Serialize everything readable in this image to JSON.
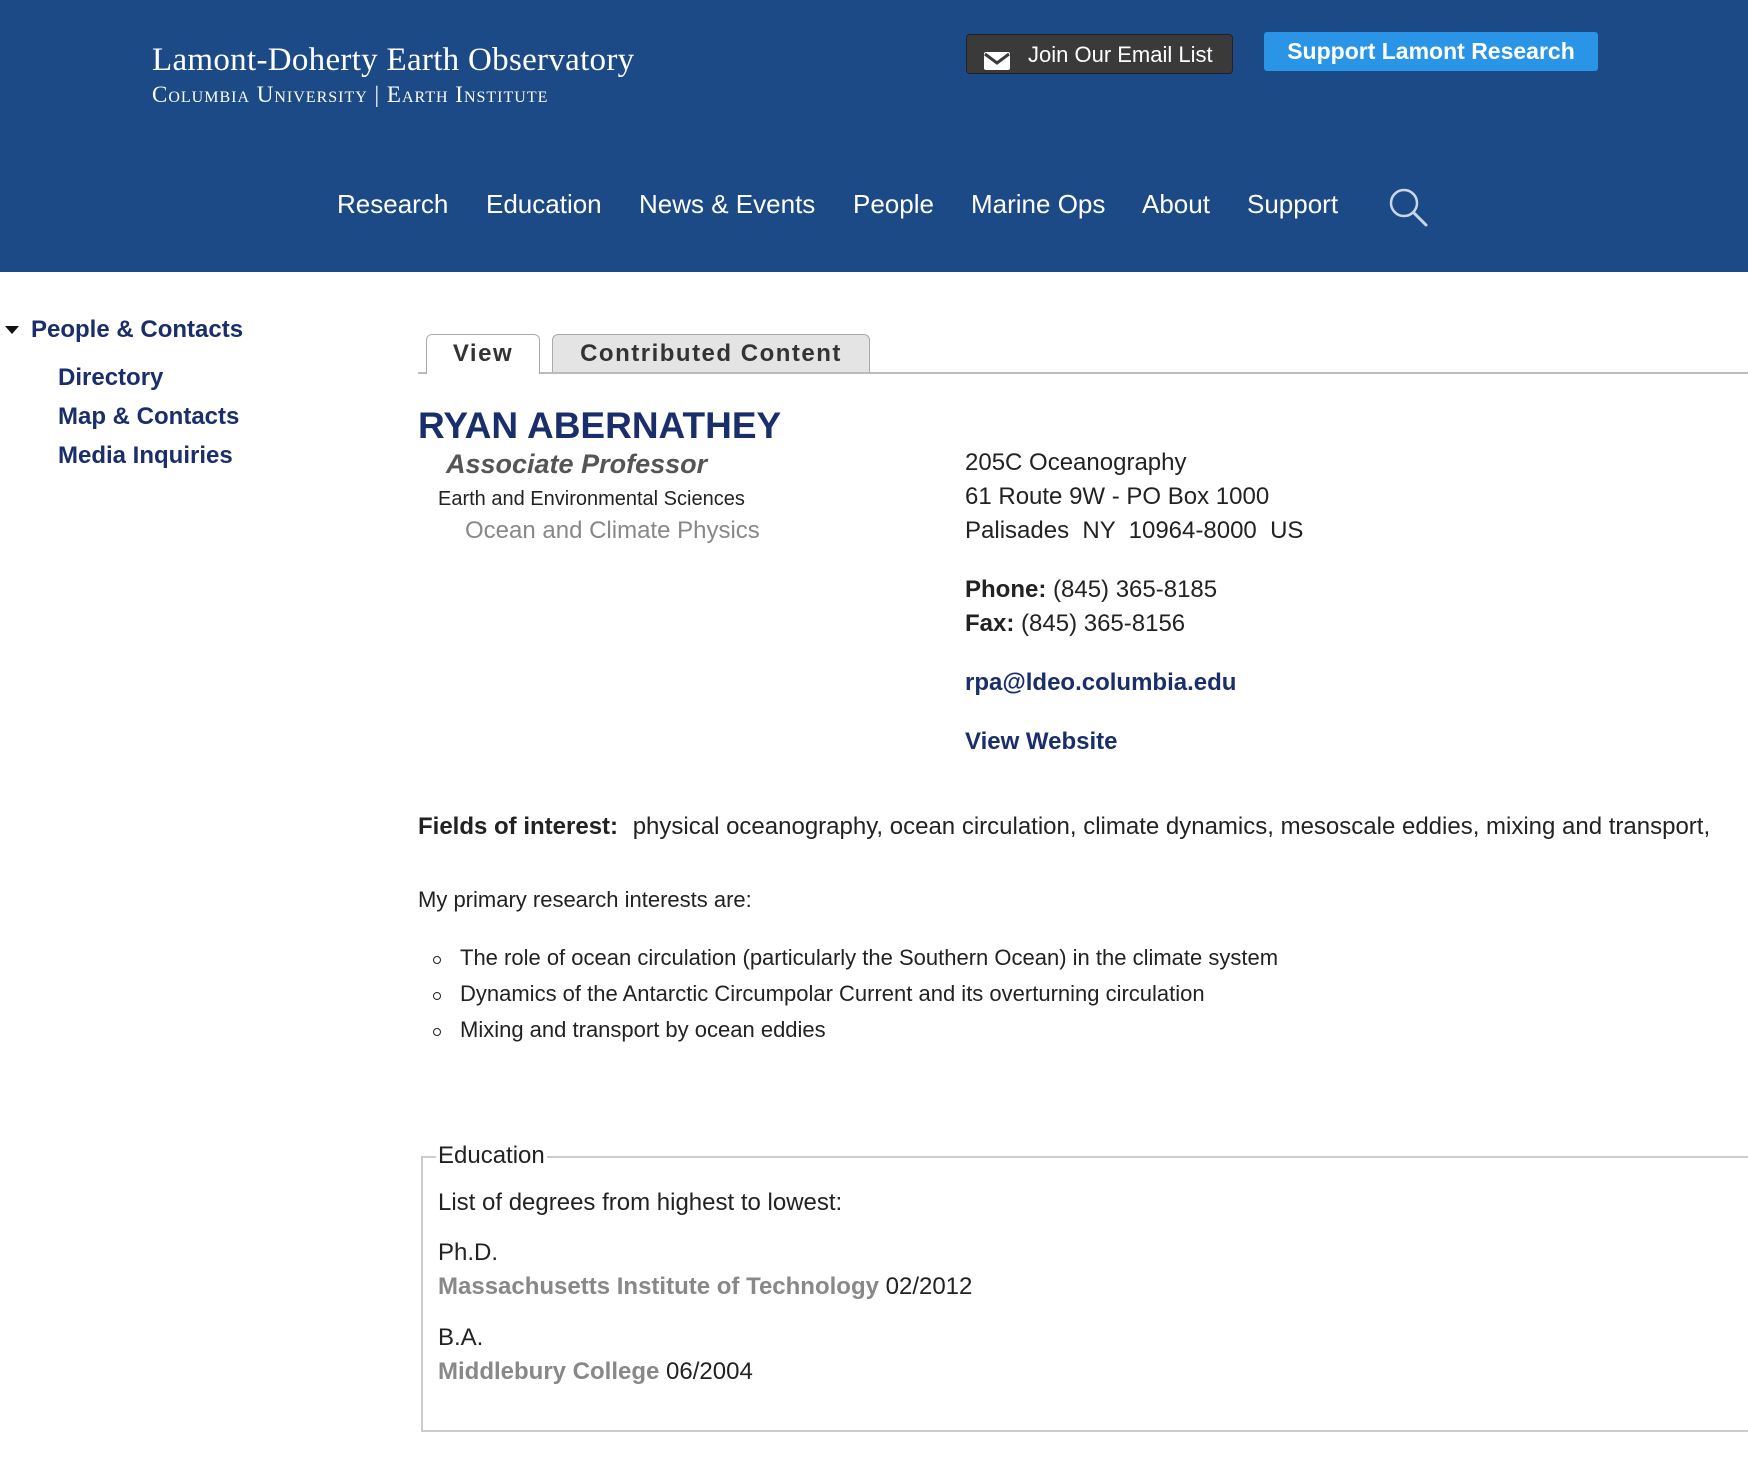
{
  "header": {
    "logo_line1": "Lamont-Doherty Earth Observatory",
    "logo_line2": "Columbia University | Earth Institute",
    "email_button": "Join Our Email List",
    "support_button": "Support Lamont Research",
    "brand_color": "#1c4a86",
    "support_color": "#2a94e6"
  },
  "nav": {
    "items": [
      "Research",
      "Education",
      "News & Events",
      "People",
      "Marine Ops",
      "About",
      "Support"
    ]
  },
  "sidebar": {
    "heading": "People & Contacts",
    "links": [
      "Directory",
      "Map & Contacts",
      "Media Inquiries"
    ]
  },
  "tabs": [
    "View",
    "Contributed Content"
  ],
  "profile": {
    "name": "RYAN ABERNATHEY",
    "title": "Associate Professor",
    "department": "Earth and Environmental Sciences",
    "division": "Ocean and Climate Physics",
    "address_lines": [
      "205C Oceanography",
      "61 Route 9W - PO Box 1000",
      "Palisades  NY  10964-8000  US"
    ],
    "phone_label": "Phone:",
    "phone": "(845) 365-8185",
    "fax_label": "Fax:",
    "fax": "(845) 365-8156",
    "email": "rpa@ldeo.columbia.edu",
    "website_label": "View Website"
  },
  "interests": {
    "label": "Fields of interest:",
    "value": "physical oceanography, ocean circulation, climate dynamics, mesoscale eddies, mixing and transport,",
    "intro": "My primary research interests are:",
    "bullets": [
      "The role of ocean circulation (particularly the Southern Ocean) in the climate system",
      "Dynamics of the Antarctic Circumpolar Current and its overturning circulation",
      "Mixing and transport by ocean eddies"
    ]
  },
  "education": {
    "legend": "Education",
    "intro": "List of degrees from highest to lowest:",
    "degrees": [
      {
        "degree": "Ph.D.",
        "institution": "Massachusetts Institute of Technology",
        "date": "02/2012"
      },
      {
        "degree": "B.A.",
        "institution": "Middlebury College",
        "date": "06/2004"
      }
    ]
  }
}
